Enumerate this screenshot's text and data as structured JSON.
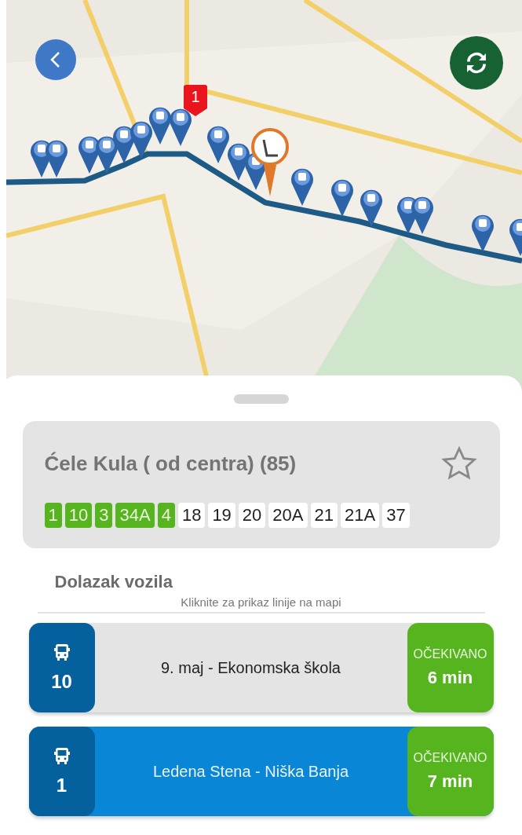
{
  "map": {
    "vehicle_marker": {
      "label": "1"
    }
  },
  "stop": {
    "title": "Ćele Kula ( od centra) (85)",
    "favorite": false,
    "lines": [
      {
        "label": "1",
        "selected": true
      },
      {
        "label": "10",
        "selected": true
      },
      {
        "label": "3",
        "selected": true
      },
      {
        "label": "34A",
        "selected": true
      },
      {
        "label": "4",
        "selected": true
      },
      {
        "label": "18",
        "selected": false
      },
      {
        "label": "19",
        "selected": false
      },
      {
        "label": "20",
        "selected": false
      },
      {
        "label": "20A",
        "selected": false
      },
      {
        "label": "21",
        "selected": false
      },
      {
        "label": "21A",
        "selected": false
      },
      {
        "label": "37",
        "selected": false
      }
    ]
  },
  "arrivals": {
    "title": "Dolazak vozila",
    "hint": "Kliknite za prikaz linije na mapi",
    "items": [
      {
        "line": "10",
        "route": "9. maj - Ekonomska škola",
        "status": "OČEKIVANO",
        "time": "6 min",
        "selected": false
      },
      {
        "line": "1",
        "route": "Ledena Stena - Niška Banja",
        "status": "OČEKIVANO",
        "time": "7 min",
        "selected": true
      }
    ]
  }
}
